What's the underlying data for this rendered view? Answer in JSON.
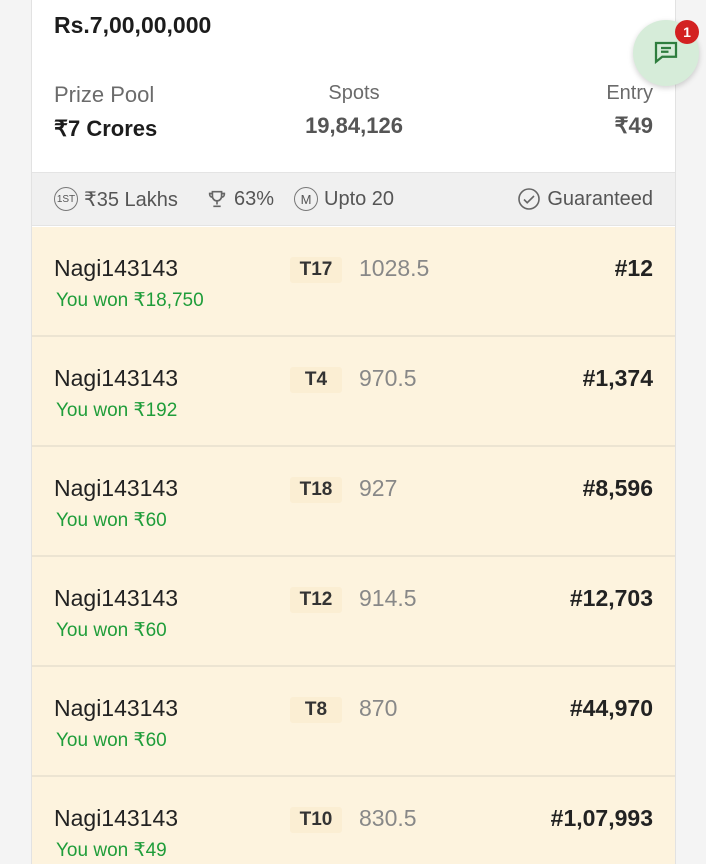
{
  "contest": {
    "title": "Rs.7,00,00,000",
    "prize_pool_label": "Prize Pool",
    "prize_pool_value": "₹7 Crores",
    "spots_label": "Spots",
    "spots_value": "19,84,126",
    "entry_label": "Entry",
    "entry_value": "₹49"
  },
  "info_bar": {
    "first_prize_badge": "1ST",
    "first_prize": "₹35 Lakhs",
    "winners_pct": "63%",
    "multi_badge": "M",
    "max_entries": "Upto 20",
    "guaranteed": "Guaranteed"
  },
  "chat": {
    "icon": "chat-icon",
    "unread_count": "1"
  },
  "entries": [
    {
      "name": "Nagi143143",
      "won": "You won ₹18,750",
      "team": "T17",
      "points": "1028.5",
      "rank": "#12"
    },
    {
      "name": "Nagi143143",
      "won": "You won ₹192",
      "team": "T4",
      "points": "970.5",
      "rank": "#1,374"
    },
    {
      "name": "Nagi143143",
      "won": "You won ₹60",
      "team": "T18",
      "points": "927",
      "rank": "#8,596"
    },
    {
      "name": "Nagi143143",
      "won": "You won ₹60",
      "team": "T12",
      "points": "914.5",
      "rank": "#12,703"
    },
    {
      "name": "Nagi143143",
      "won": "You won ₹60",
      "team": "T8",
      "points": "870",
      "rank": "#44,970"
    },
    {
      "name": "Nagi143143",
      "won": "You won ₹49",
      "team": "T10",
      "points": "830.5",
      "rank": "#1,07,993"
    }
  ],
  "colors": {
    "row_background": "#fdf3de",
    "won_text": "#1f9d3a",
    "chat_fab": "#d6ecd9",
    "badge_red": "#d32121"
  }
}
